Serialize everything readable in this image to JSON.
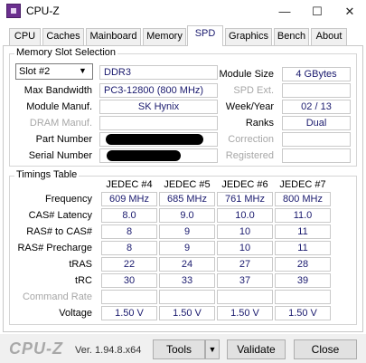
{
  "window": {
    "title": "CPU-Z",
    "minimize": "—",
    "maximize": "☐",
    "close": "✕"
  },
  "tabs": [
    "CPU",
    "Caches",
    "Mainboard",
    "Memory",
    "SPD",
    "Graphics",
    "Bench",
    "About"
  ],
  "active_tab": "SPD",
  "slot_group": {
    "title": "Memory Slot Selection",
    "slot_select": "Slot #2",
    "memory_type": "DDR3",
    "left_rows": [
      {
        "label": "Max Bandwidth",
        "value": "PC3-12800 (800 MHz)"
      },
      {
        "label": "Module Manuf.",
        "value": "SK Hynix"
      },
      {
        "label": "DRAM Manuf.",
        "value": ""
      },
      {
        "label": "Part Number",
        "value": ""
      },
      {
        "label": "Serial Number",
        "value": ""
      }
    ],
    "right_rows": [
      {
        "label": "Module Size",
        "value": "4 GBytes"
      },
      {
        "label": "SPD Ext.",
        "value": ""
      },
      {
        "label": "Week/Year",
        "value": "02 / 13"
      },
      {
        "label": "Ranks",
        "value": "Dual"
      },
      {
        "label": "Correction",
        "value": ""
      },
      {
        "label": "Registered",
        "value": ""
      }
    ]
  },
  "timings_group": {
    "title": "Timings Table",
    "columns": [
      "JEDEC #4",
      "JEDEC #5",
      "JEDEC #6",
      "JEDEC #7"
    ],
    "rows": [
      {
        "label": "Frequency",
        "values": [
          "609 MHz",
          "685 MHz",
          "761 MHz",
          "800 MHz"
        ]
      },
      {
        "label": "CAS# Latency",
        "values": [
          "8.0",
          "9.0",
          "10.0",
          "11.0"
        ]
      },
      {
        "label": "RAS# to CAS#",
        "values": [
          "8",
          "9",
          "10",
          "11"
        ]
      },
      {
        "label": "RAS# Precharge",
        "values": [
          "8",
          "9",
          "10",
          "11"
        ]
      },
      {
        "label": "tRAS",
        "values": [
          "22",
          "24",
          "27",
          "28"
        ]
      },
      {
        "label": "tRC",
        "values": [
          "30",
          "33",
          "37",
          "39"
        ]
      },
      {
        "label": "Command Rate",
        "values": [
          "",
          "",
          "",
          ""
        ]
      },
      {
        "label": "Voltage",
        "values": [
          "1.50 V",
          "1.50 V",
          "1.50 V",
          "1.50 V"
        ]
      }
    ]
  },
  "footer": {
    "logo": "CPU-Z",
    "version": "Ver. 1.94.8.x64",
    "tools_label": "Tools",
    "validate_label": "Validate",
    "close_label": "Close"
  }
}
